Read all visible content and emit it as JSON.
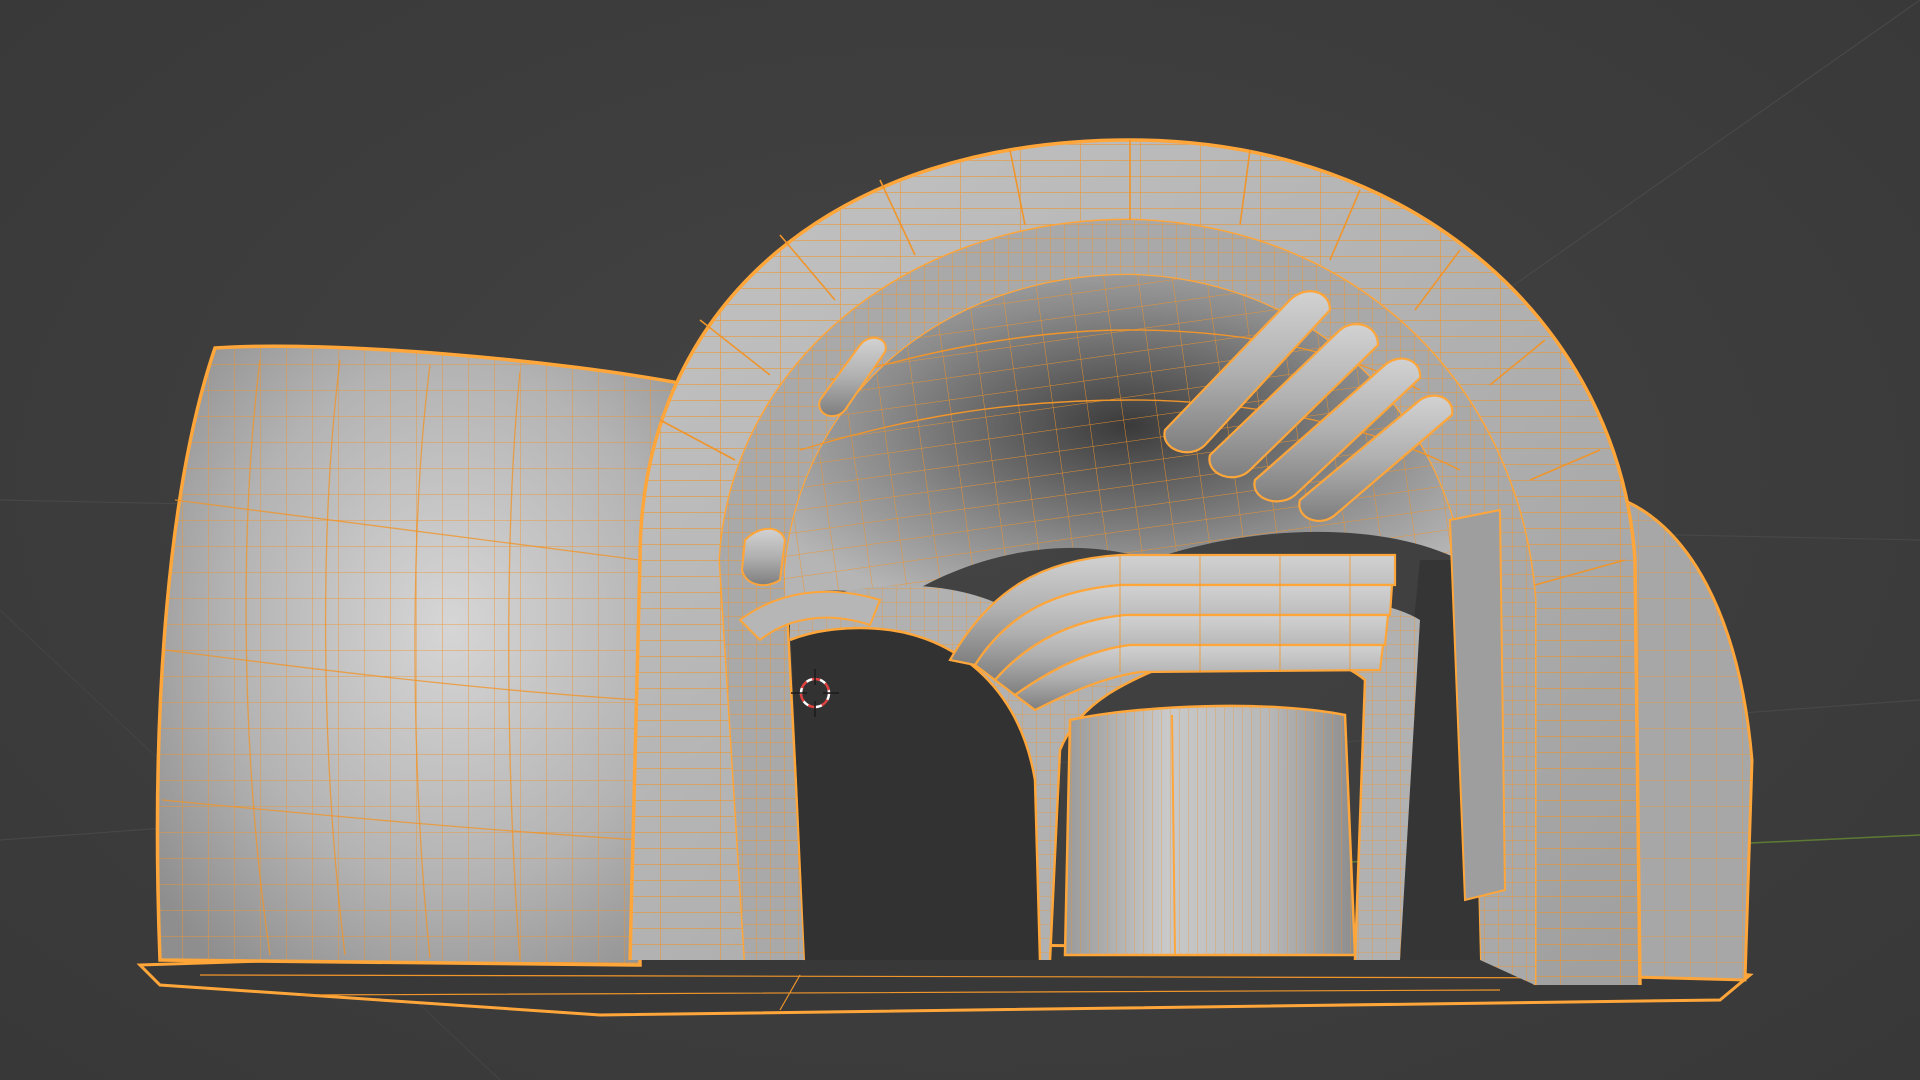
{
  "viewport": {
    "shading": "solid",
    "overlay": "wireframe",
    "selection_state": "selected"
  },
  "scene": {
    "object": "arched-tunnel-kitbash",
    "parts": [
      "left-curved-wall",
      "outer-arch-ring",
      "inner-arch-ring",
      "ceiling-vault",
      "right-side-pipes",
      "center-pipe-bundle",
      "inner-tunnel-ring",
      "center-pillar",
      "right-end-wall",
      "floor-base"
    ]
  },
  "colors": {
    "background": "#3d3d3d",
    "mesh_surface": "#b9b9b9",
    "mesh_shadow": "#8c8c8c",
    "cavity_dark": "#2f2f2f",
    "selection_wire": "#f0952a",
    "selection_outline": "#ffa63a",
    "axis_x": "#7a3838",
    "axis_y": "#5d7a34",
    "grid_line": "#4b4b4b",
    "cursor_red": "#e04040",
    "cursor_white": "#ffffff"
  },
  "icons": {
    "cursor": "3d-cursor-icon"
  }
}
